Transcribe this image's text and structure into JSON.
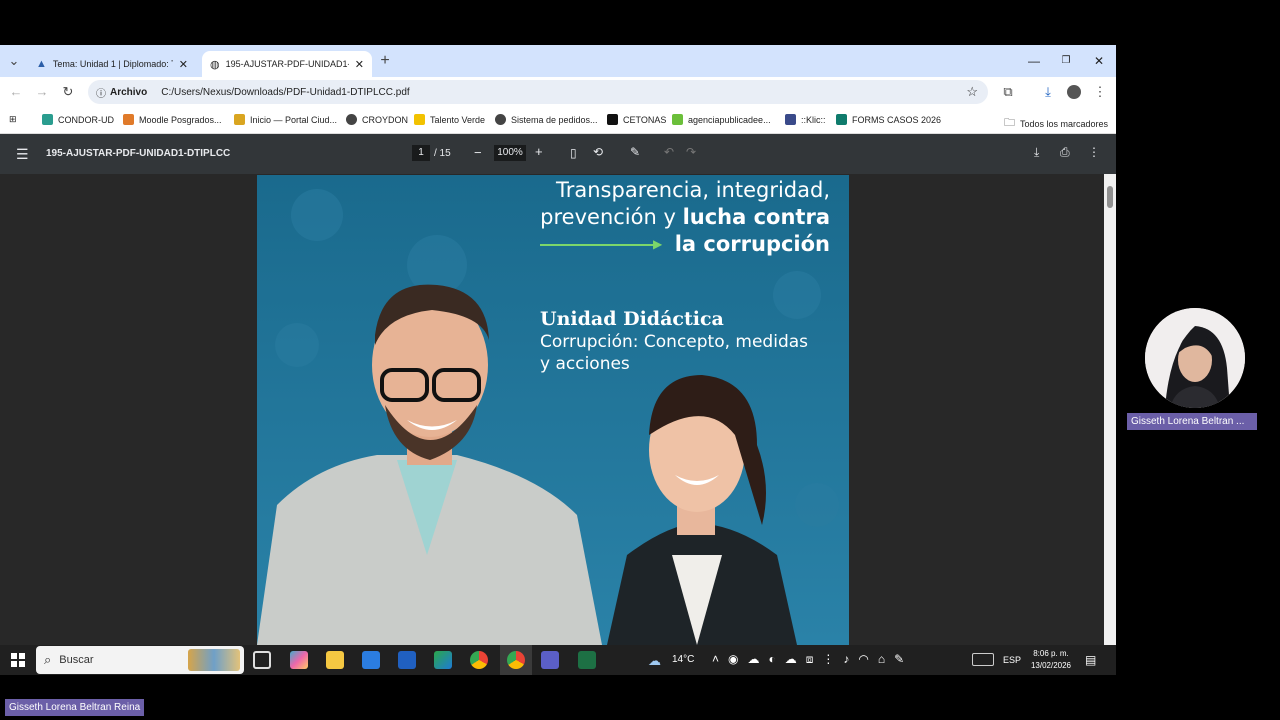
{
  "browser": {
    "tabs": [
      {
        "title": "Tema: Unidad 1 | Diplomado: Tr",
        "active": false
      },
      {
        "title": "195-AJUSTAR-PDF-UNIDAD1-D",
        "active": true
      }
    ],
    "url_chip": "Archivo",
    "url": "C:/Users/Nexus/Downloads/PDF-Unidad1-DTIPLCC.pdf",
    "bookmarks": [
      "CONDOR-UD",
      "Moodle Posgrados...",
      "Inicio — Portal Ciud...",
      "CROYDON",
      "Talento Verde",
      "Sistema de pedidos...",
      "CETONAS",
      "agenciapublicadee...",
      "::Klic::",
      "FORMS CASOS 2026"
    ],
    "all_bookmarks": "Todos los marcadores"
  },
  "pdf": {
    "filename": "195-AJUSTAR-PDF-UNIDAD1-DTIPLCC",
    "page_current": "1",
    "page_total": "/ 15",
    "zoom": "100%",
    "cover": {
      "headline_line1": "Transparencia, integridad,",
      "headline_line2_plain": "prevención y ",
      "headline_line2_bold": "lucha contra",
      "headline_line3": "la corrupción",
      "unit_label": "Unidad Didáctica",
      "unit_title_line1": "Corrupción: Concepto, medidas",
      "unit_title_line2": "y acciones"
    }
  },
  "taskbar": {
    "search_placeholder": "Buscar",
    "weather": "14°C",
    "language": "ESP",
    "time": "8:06 p. m.",
    "date": "13/02/2026"
  },
  "meeting": {
    "participant_name": "Gisseth Lorena Beltran ...",
    "self_name": "Gisseth Lorena Beltran Reina"
  },
  "colors": {
    "accent": "#d3e3fd",
    "pdf_toolbar": "#323639",
    "cover_blue": "#1f6f93",
    "name_chip": "#6b5fa8"
  }
}
